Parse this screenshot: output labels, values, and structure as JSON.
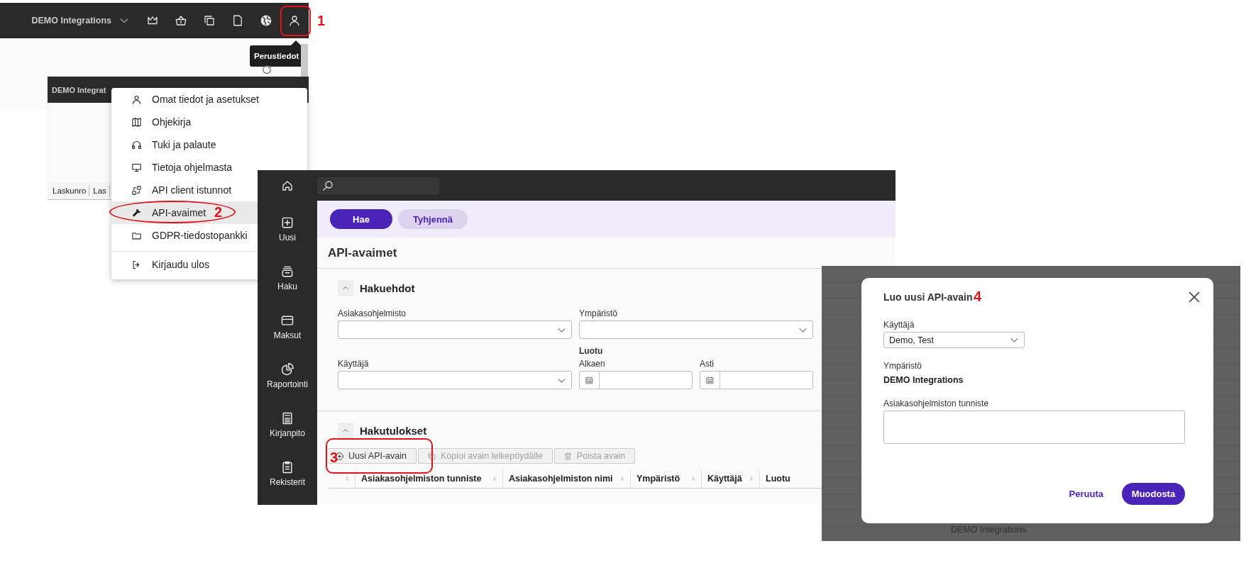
{
  "topbar_screenshot": {
    "workspace": "DEMO Integrations",
    "tooltip": "Perustiedot"
  },
  "list_screenshot": {
    "workspace": "DEMO Integrat",
    "columns": [
      "Laskunro",
      "Las"
    ]
  },
  "user_menu": {
    "items": [
      {
        "label": "Omat tiedot ja asetukset",
        "selected": false
      },
      {
        "label": "Ohjekirja",
        "selected": false
      },
      {
        "label": "Tuki ja palaute",
        "selected": false
      },
      {
        "label": "Tietoja ohjelmasta",
        "selected": false
      },
      {
        "label": "API client istunnot",
        "selected": false
      },
      {
        "label": "API-avaimet",
        "selected": true
      },
      {
        "label": "GDPR-tiedostopankki",
        "selected": false
      }
    ],
    "bottom_items": [
      {
        "label": "Kirjaudu ulos",
        "selected": false
      }
    ]
  },
  "app": {
    "sidebar": {
      "items": [
        {
          "label": "Uusi"
        },
        {
          "label": "Haku"
        },
        {
          "label": "Maksut"
        },
        {
          "label": "Raportointi"
        },
        {
          "label": "Kirjanpito"
        },
        {
          "label": "Rekisterit"
        }
      ]
    },
    "actions": [
      {
        "label": "Hae",
        "kind": "primary"
      },
      {
        "label": "Tyhjennä",
        "kind": "secondary"
      }
    ],
    "page_title": "API-avaimet",
    "criteria": {
      "title": "Hakuehdot",
      "expanded": true,
      "fields": [
        {
          "kind": "select",
          "label": "Asiakasohjelmisto"
        },
        {
          "kind": "select",
          "label": "Käyttäjä"
        },
        {
          "kind": "select",
          "label": "Ympäristö"
        },
        {
          "kind": "date-range",
          "label": "Luotu",
          "fields": [
            {
              "label": "Alkaen"
            },
            {
              "label": "Asti"
            }
          ]
        }
      ]
    },
    "results": {
      "title": "Hakutulokset",
      "expanded": true,
      "toolbar": [
        {
          "label": "Uusi API-avain",
          "disabled": false
        },
        {
          "label": "Kopioi avain leikepöydälle",
          "disabled": true
        },
        {
          "label": "Poista avain",
          "disabled": true
        }
      ],
      "columns": [
        "Asiakasohjelmiston tunniste",
        "Asiakasohjelmiston nimi",
        "Ympäristö",
        "Käyttäjä",
        "Luotu"
      ]
    }
  },
  "dialog_screenshot": {
    "background_text": "DEMO Integrations",
    "dialog": {
      "title": "Luo uusi API-avain",
      "fields": [
        {
          "kind": "select",
          "label": "Käyttäjä",
          "value": "Demo, Test"
        },
        {
          "kind": "static",
          "label": "Ympäristö",
          "value": "DEMO Integrations"
        },
        {
          "kind": "textarea",
          "label": "Asiakasohjelmiston tunniste"
        }
      ],
      "buttons": [
        {
          "kind": "link",
          "label": "Peruuta"
        },
        {
          "kind": "primary",
          "label": "Muodosta"
        }
      ]
    }
  },
  "annotations": [
    {
      "number": "1",
      "kind": "rounded"
    },
    {
      "number": "2",
      "kind": "oval"
    },
    {
      "number": "3",
      "kind": "rounded"
    },
    {
      "number": "4",
      "kind": "none"
    }
  ]
}
